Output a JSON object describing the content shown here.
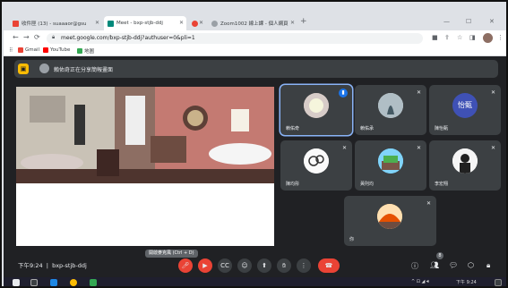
{
  "browser": {
    "tabs": [
      {
        "title": "收件匣 (13) - suaaaor@gsu",
        "active": false,
        "favicon_color": "#ea4335"
      },
      {
        "title": "Meet - bxp-stjb-ddj",
        "active": true,
        "favicon_color": "#00897b"
      },
      {
        "title": "",
        "active": false,
        "favicon_color": "#ea4335"
      },
      {
        "title": "Zoom1002 線上課 - 個人網頁",
        "active": false,
        "favicon_color": "#5f6368"
      }
    ],
    "new_tab": "+",
    "url": "meet.google.com/bxp-stjb-ddj?authuser=0&pli=1",
    "bookmarks": [
      {
        "label": "Gmail",
        "color": "#ea4335"
      },
      {
        "label": "YouTube",
        "color": "#ff0000"
      },
      {
        "label": "地圖",
        "color": "#34a853"
      }
    ]
  },
  "meet": {
    "presenter_banner": "賴佑奇正在分享簡報畫面",
    "participants": [
      {
        "name": "賴佑奇",
        "speaking": true,
        "color": "#bcaaa4"
      },
      {
        "name": "賴佑承",
        "speaking": false,
        "color": "#cfd8dc"
      },
      {
        "name": "陳怡甄",
        "speaking": false,
        "color": "#3f51b5",
        "avatar_text": "怡甄"
      },
      {
        "name": "陳均彤",
        "speaking": false,
        "color": "#e0e0e0"
      },
      {
        "name": "黃則均",
        "speaking": false,
        "color": "#4fc3f7"
      },
      {
        "name": "李宏翔",
        "speaking": false,
        "color": "#eeeeee"
      },
      {
        "name": "你",
        "speaking": false,
        "color": "#ffb74d"
      }
    ],
    "time": "下午9:24",
    "meeting_code": "bxp-stjb-ddj",
    "mic_tooltip": "開啟麥克風 (Ctrl + D)",
    "participant_count": "8"
  },
  "taskbar": {
    "clock": "下午 9:24",
    "date": "2021/5/24"
  }
}
